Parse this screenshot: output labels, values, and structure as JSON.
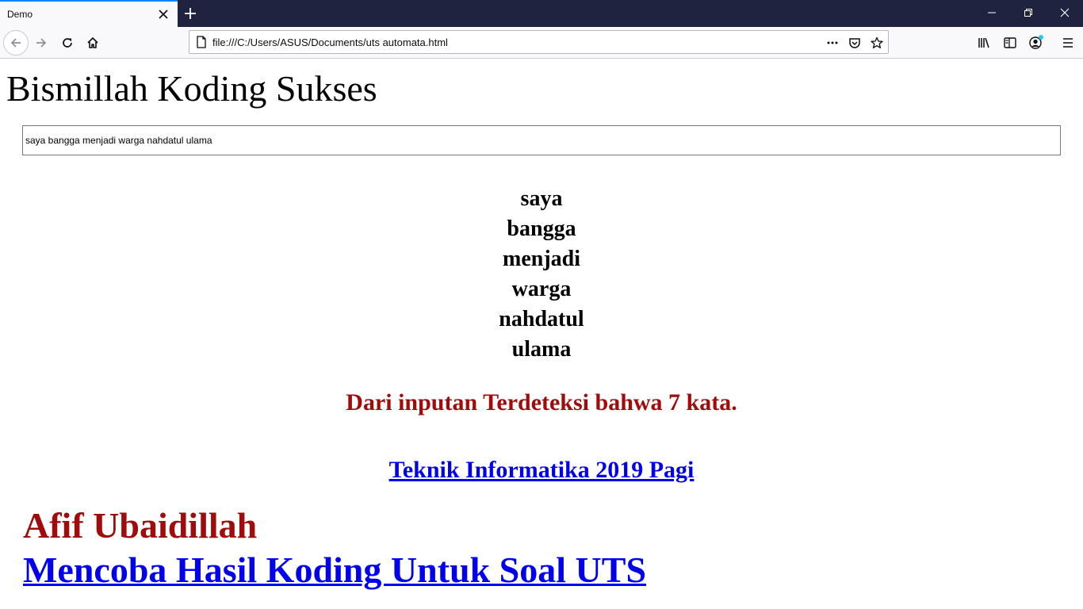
{
  "browser": {
    "tab": {
      "title": "Demo"
    },
    "url": "file:///C:/Users/ASUS/Documents/uts automata.html",
    "icons": {
      "tab_close": "close-icon",
      "new_tab": "plus-icon",
      "minimize": "minimize-icon",
      "restore": "restore-icon",
      "close_window": "close-icon",
      "back": "arrow-left-icon",
      "forward": "arrow-right-icon",
      "reload": "reload-icon",
      "home": "home-icon",
      "page": "page-icon",
      "page_actions": "more-horizontal-icon",
      "pocket": "pocket-icon",
      "bookmark": "star-icon",
      "library": "library-icon",
      "sidebar": "sidebar-icon",
      "account": "account-icon",
      "menu": "hamburger-icon"
    },
    "colors": {
      "tabbar_bg": "#202340",
      "accent": "#0a84ff"
    }
  },
  "page": {
    "title": "Bismillah Koding Sukses",
    "input_value": "saya bangga menjadi warga nahdatul ulama",
    "words": [
      "saya",
      "bangga",
      "menjadi",
      "warga",
      "nahdatul",
      "ulama"
    ],
    "result_text": "Dari inputan Terdeteksi bahwa 7 kata.",
    "class_link": "Teknik Informatika 2019 Pagi",
    "author_name": "Afif Ubaidillah",
    "project_link": "Mencoba Hasil Koding Untuk Soal UTS",
    "colors": {
      "highlight": "#a00c0c",
      "link": "#0000ee"
    }
  }
}
